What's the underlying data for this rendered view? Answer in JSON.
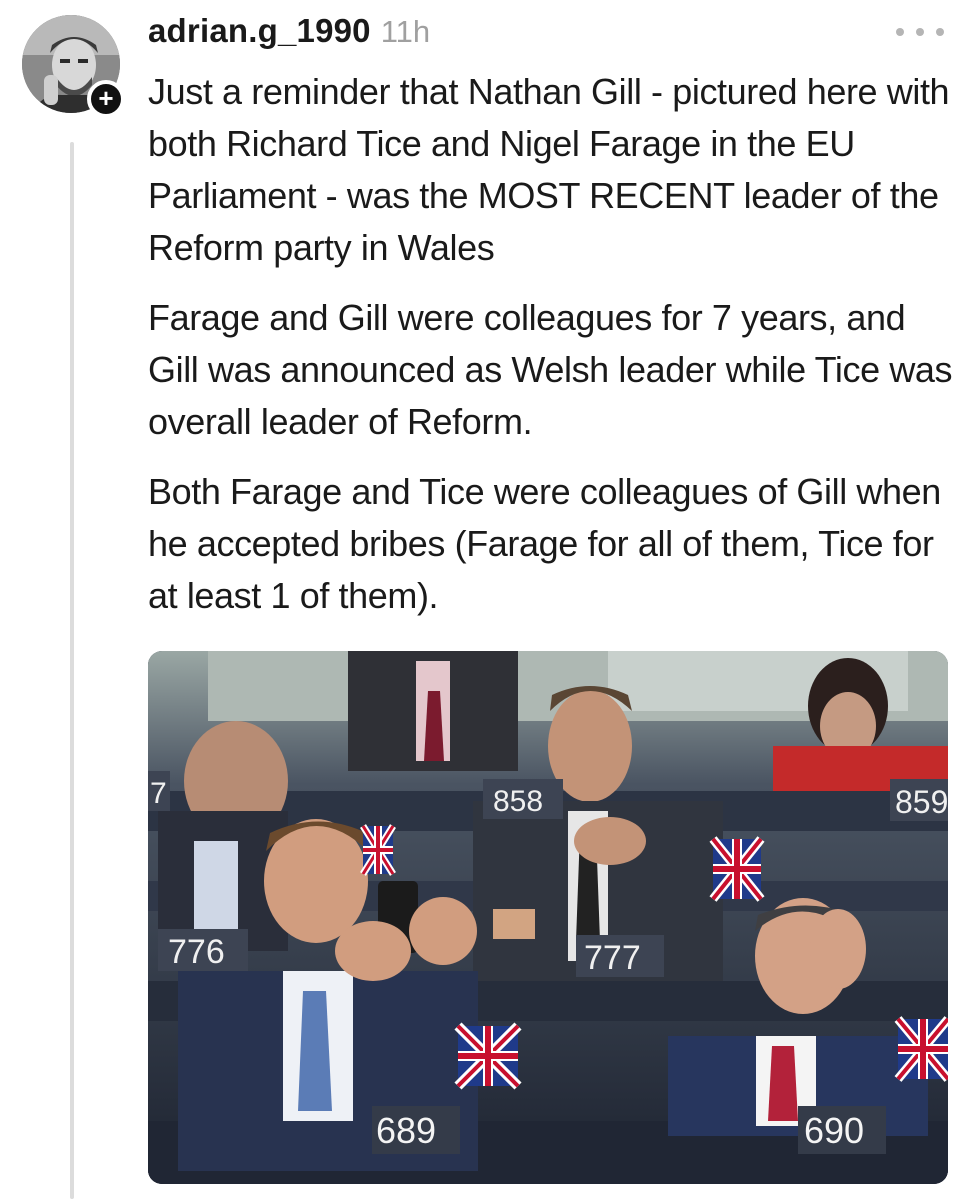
{
  "post": {
    "username": "adrian.g_1990",
    "timestamp": "11h",
    "follow_symbol": "+",
    "paragraphs": [
      "Just a reminder that Nathan Gill - pictured here with both Richard Tice and Nigel Farage in the EU Parliament - was the MOST RECENT leader of the Reform party in Wales",
      "Farage and Gill were colleagues for 7 years, and Gill was announced as Welsh leader while Tice was overall leader of Reform.",
      "Both Farage and Tice were colleagues of Gill when he accepted bribes (Farage for all of them, Tice for at least 1 of them)."
    ]
  },
  "photo": {
    "seat_numbers": [
      "776",
      "777",
      "689",
      "690",
      "858",
      "859",
      "7"
    ]
  },
  "icons": {
    "more": "more-horizontal-icon",
    "follow": "plus-icon"
  },
  "colors": {
    "text": "#1a1a1a",
    "timestamp": "#a0a0a0",
    "thread_line": "#dcdcdc"
  }
}
